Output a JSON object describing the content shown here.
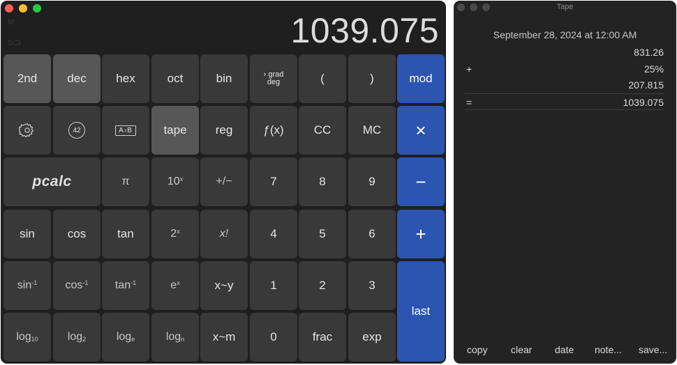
{
  "calculator": {
    "indicators": {
      "memory": "M",
      "mode": "SCI"
    },
    "display": "1039.075",
    "keys": {
      "second": "2nd",
      "dec": "dec",
      "hex": "hex",
      "oct": "oct",
      "bin": "bin",
      "grad": "grad",
      "deg": "deg",
      "paren_open": "(",
      "paren_close": ")",
      "mod": "mod",
      "convert_a": "A",
      "convert_b": "B",
      "badge": "42",
      "tape": "tape",
      "reg": "reg",
      "fx": "ƒ(x)",
      "cc": "CC",
      "mc": "MC",
      "multiply": "×",
      "brand": "pcalc",
      "pi": "π",
      "ten": "10",
      "ten_sup": "x",
      "plus_minus": "+/−",
      "seven": "7",
      "eight": "8",
      "nine": "9",
      "minus": "−",
      "sin": "sin",
      "cos": "cos",
      "tan": "tan",
      "two": "2",
      "two_sup": "x",
      "fact": "x!",
      "four": "4",
      "five": "5",
      "six": "6",
      "plus": "+",
      "asin": "sin",
      "acos": "cos",
      "atan": "tan",
      "inv_sup": "-1",
      "e": "e",
      "e_sup": "x",
      "swap_y": "x~y",
      "one": "1",
      "two_digit": "2",
      "three": "3",
      "last": "last",
      "log": "log",
      "log10_sub": "10",
      "log2_sub": "2",
      "loge_sub": "e",
      "logn_sub": "n",
      "swap_m": "x~m",
      "zero": "0",
      "frac": "frac",
      "exp": "exp"
    }
  },
  "tape": {
    "title": "Tape",
    "date": "September 28, 2024 at 12:00 AM",
    "entries": [
      {
        "op": "",
        "value": "831.26"
      },
      {
        "op": "+",
        "value": "25%"
      },
      {
        "op": "",
        "value": "207.815"
      },
      {
        "op": "=",
        "value": "1039.075"
      }
    ],
    "buttons": {
      "copy": "copy",
      "clear": "clear",
      "date": "date",
      "note": "note...",
      "save": "save..."
    }
  }
}
